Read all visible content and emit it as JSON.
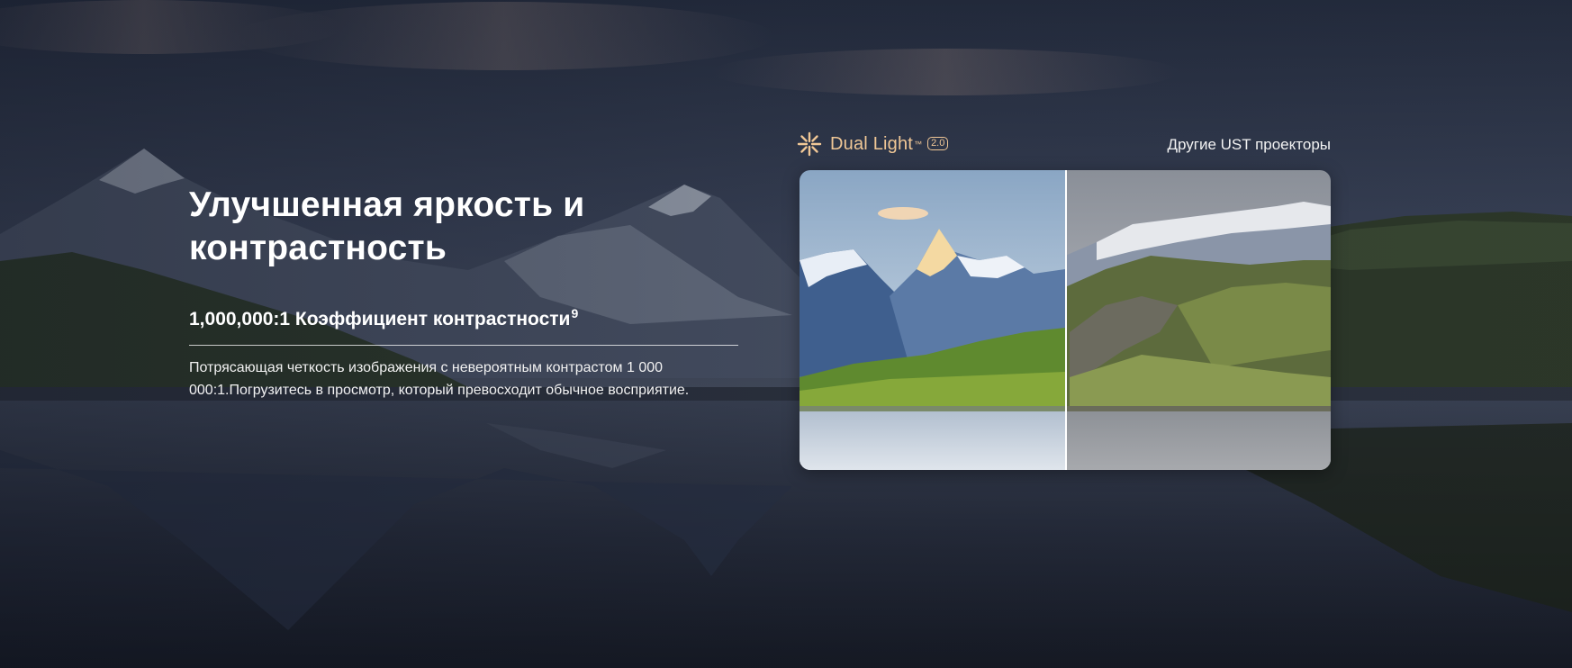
{
  "hero": {
    "headline": "Улучшенная яркость и контрастность",
    "subhead": "1,000,000:1 Коэффициент контрастности",
    "subhead_sup": "9",
    "body": "Потрясающая четкость изображения с невероятным контрастом 1 000 000:1.Погрузитесь в просмотр, который превосходит обычное восприятие."
  },
  "compare": {
    "brand_name": "Dual Light",
    "brand_tm": "™",
    "brand_badge": "2.0",
    "other_label": "Другие UST проекторы",
    "brand_icon": "sparkle-icon"
  },
  "colors": {
    "brand_accent": "#f0c796",
    "text": "#ffffff"
  }
}
